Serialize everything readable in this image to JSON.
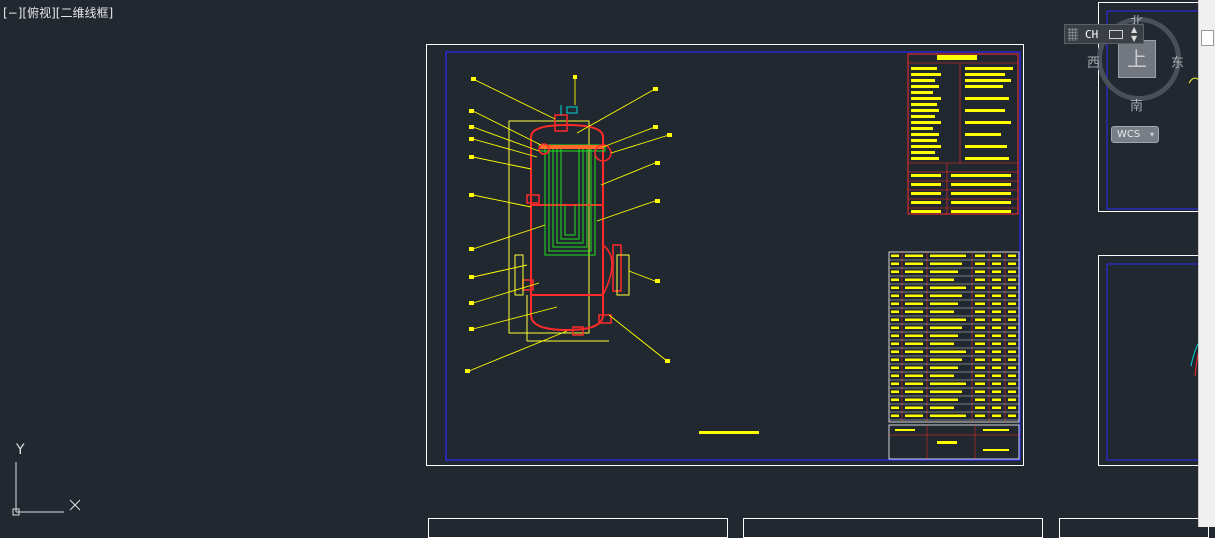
{
  "viewport": {
    "label": "[−][俯视][二维线框]"
  },
  "ime": {
    "text": "CH",
    "keyboard_icon": "keyboard-icon"
  },
  "viewcube": {
    "north": "北",
    "south": "南",
    "east": "东",
    "west": "西",
    "top": "上",
    "wcs": "WCS"
  },
  "ucs": {
    "y_label": "Y"
  },
  "colors": {
    "background": "#212830",
    "frame": "#ffffff",
    "border_blue": "#1a1aff",
    "red": "#ff2020",
    "yellow": "#ffff00",
    "green": "#00e000",
    "cyan": "#00d8d8"
  }
}
